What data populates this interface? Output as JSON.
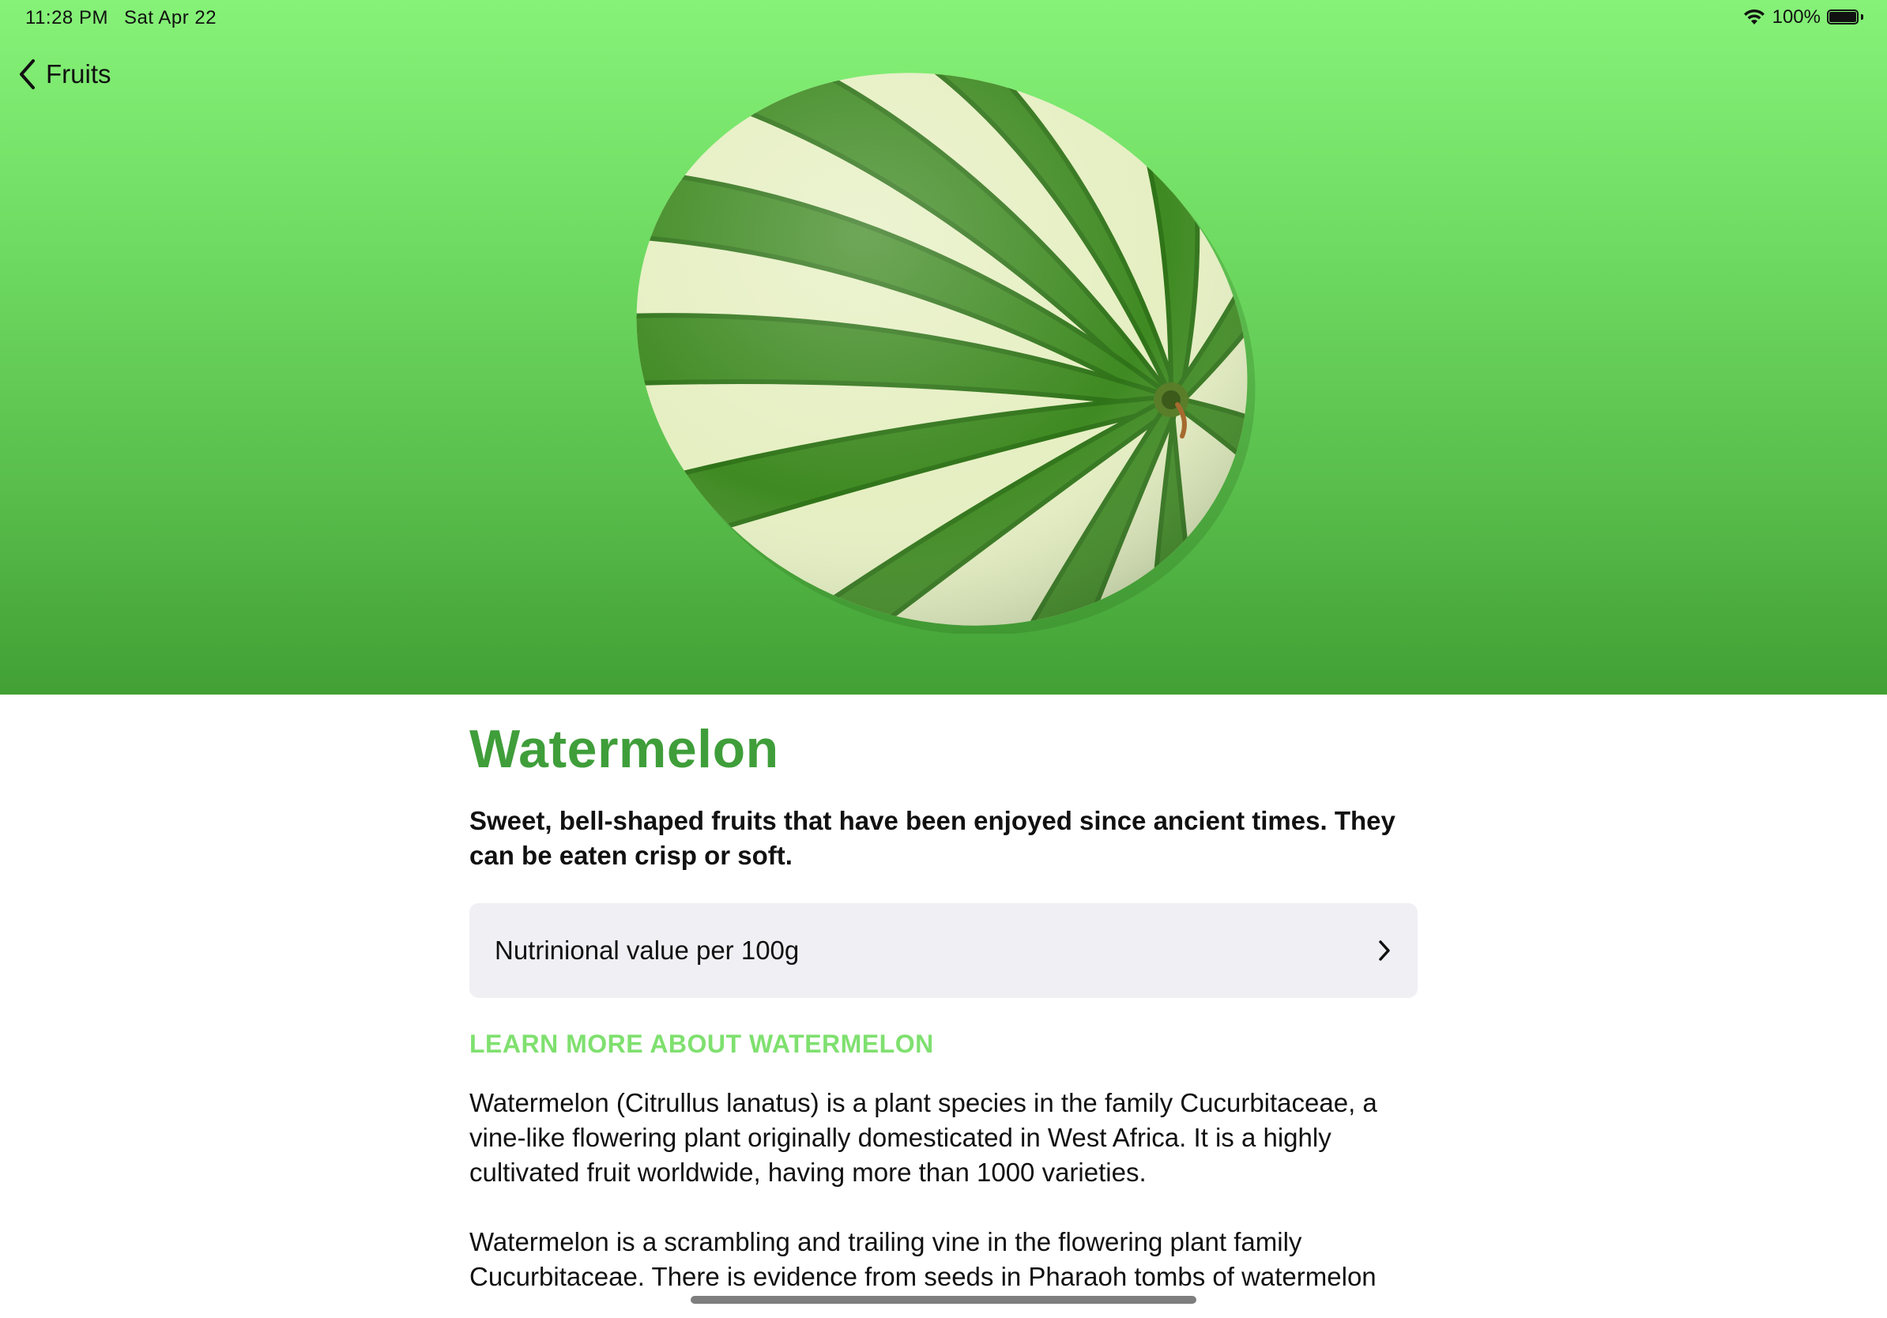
{
  "status_bar": {
    "time": "11:28 PM",
    "date": "Sat Apr 22",
    "battery": "100%",
    "wifi_icon": "wifi-icon",
    "battery_icon": "battery-full-icon"
  },
  "nav": {
    "back_label": "Fruits",
    "back_icon": "chevron-left-icon"
  },
  "hero": {
    "image": "watermelon-image",
    "gradient_top": "#86f278",
    "gradient_bottom": "#42a034"
  },
  "fruit": {
    "name": "Watermelon",
    "tagline": "Sweet, bell-shaped fruits that have been enjoyed since ancient times. They can be eaten crisp or soft.",
    "title_color": "#3f9e3a"
  },
  "nutrition": {
    "label": "Nutrinional value per 100g",
    "chevron_icon": "chevron-right-icon"
  },
  "learn_more": {
    "heading": "LEARN MORE ABOUT WATERMELON",
    "color": "#7fe06f",
    "paragraphs": [
      "Watermelon (Citrullus lanatus) is a plant species in the family Cucurbitaceae, a vine-like flowering plant originally domesticated in West Africa. It is a highly cultivated fruit worldwide, having more than 1000 varieties.",
      "Watermelon is a scrambling and trailing vine in the flowering plant family Cucurbitaceae. There is evidence from seeds in Pharaoh tombs of watermelon"
    ]
  }
}
